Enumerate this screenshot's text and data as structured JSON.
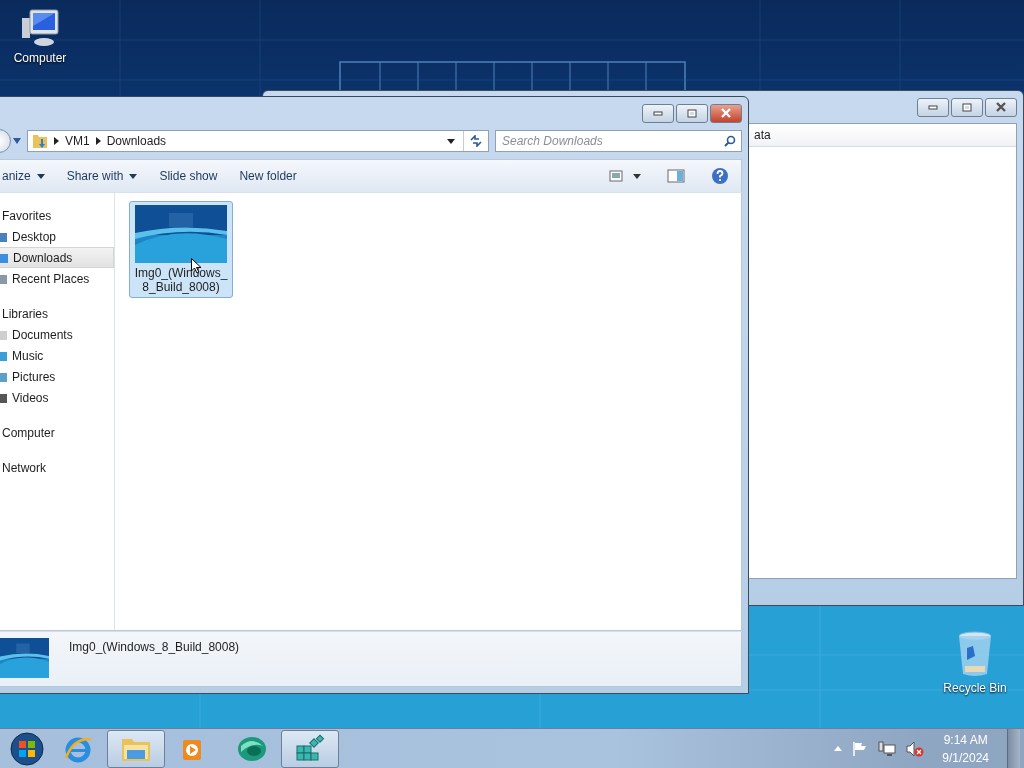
{
  "desktop_icons": [
    {
      "label": "Computer",
      "kind": "computer"
    },
    {
      "label": "Recycle Bin",
      "kind": "recycle"
    }
  ],
  "back_window": {
    "column_header": "ata"
  },
  "explorer": {
    "address": {
      "segments": [
        "VM1",
        "Downloads"
      ]
    },
    "search": {
      "placeholder": "Search Downloads"
    },
    "toolbar": [
      {
        "label": "anize",
        "dropdown": true
      },
      {
        "label": "Share with",
        "dropdown": true
      },
      {
        "label": "Slide show",
        "dropdown": false
      },
      {
        "label": "New folder",
        "dropdown": false
      }
    ],
    "nav": [
      {
        "label": "Favorites",
        "selected": false,
        "children": [
          {
            "label": "Desktop",
            "selected": false
          },
          {
            "label": "Downloads",
            "selected": true
          },
          {
            "label": "Recent Places",
            "selected": false
          }
        ]
      },
      {
        "label": "Libraries",
        "selected": false,
        "children": [
          {
            "label": "Documents",
            "selected": false
          },
          {
            "label": "Music",
            "selected": false
          },
          {
            "label": "Pictures",
            "selected": false
          },
          {
            "label": "Videos",
            "selected": false
          }
        ]
      },
      {
        "label": "Computer",
        "selected": false
      },
      {
        "label": "Network",
        "selected": false
      }
    ],
    "files": [
      {
        "name": "Img0_(Windows_8_Build_8008)",
        "selected": true
      }
    ],
    "details": {
      "name": "Img0_(Windows_8_Build_8008)"
    }
  },
  "taskbar": {
    "apps": [
      {
        "kind": "ie",
        "active": false
      },
      {
        "kind": "explorer",
        "active": true
      },
      {
        "kind": "media",
        "active": false
      },
      {
        "kind": "globe",
        "active": false
      },
      {
        "kind": "registry",
        "active": true
      }
    ],
    "time": "9:14 AM",
    "date": "9/1/2024"
  }
}
